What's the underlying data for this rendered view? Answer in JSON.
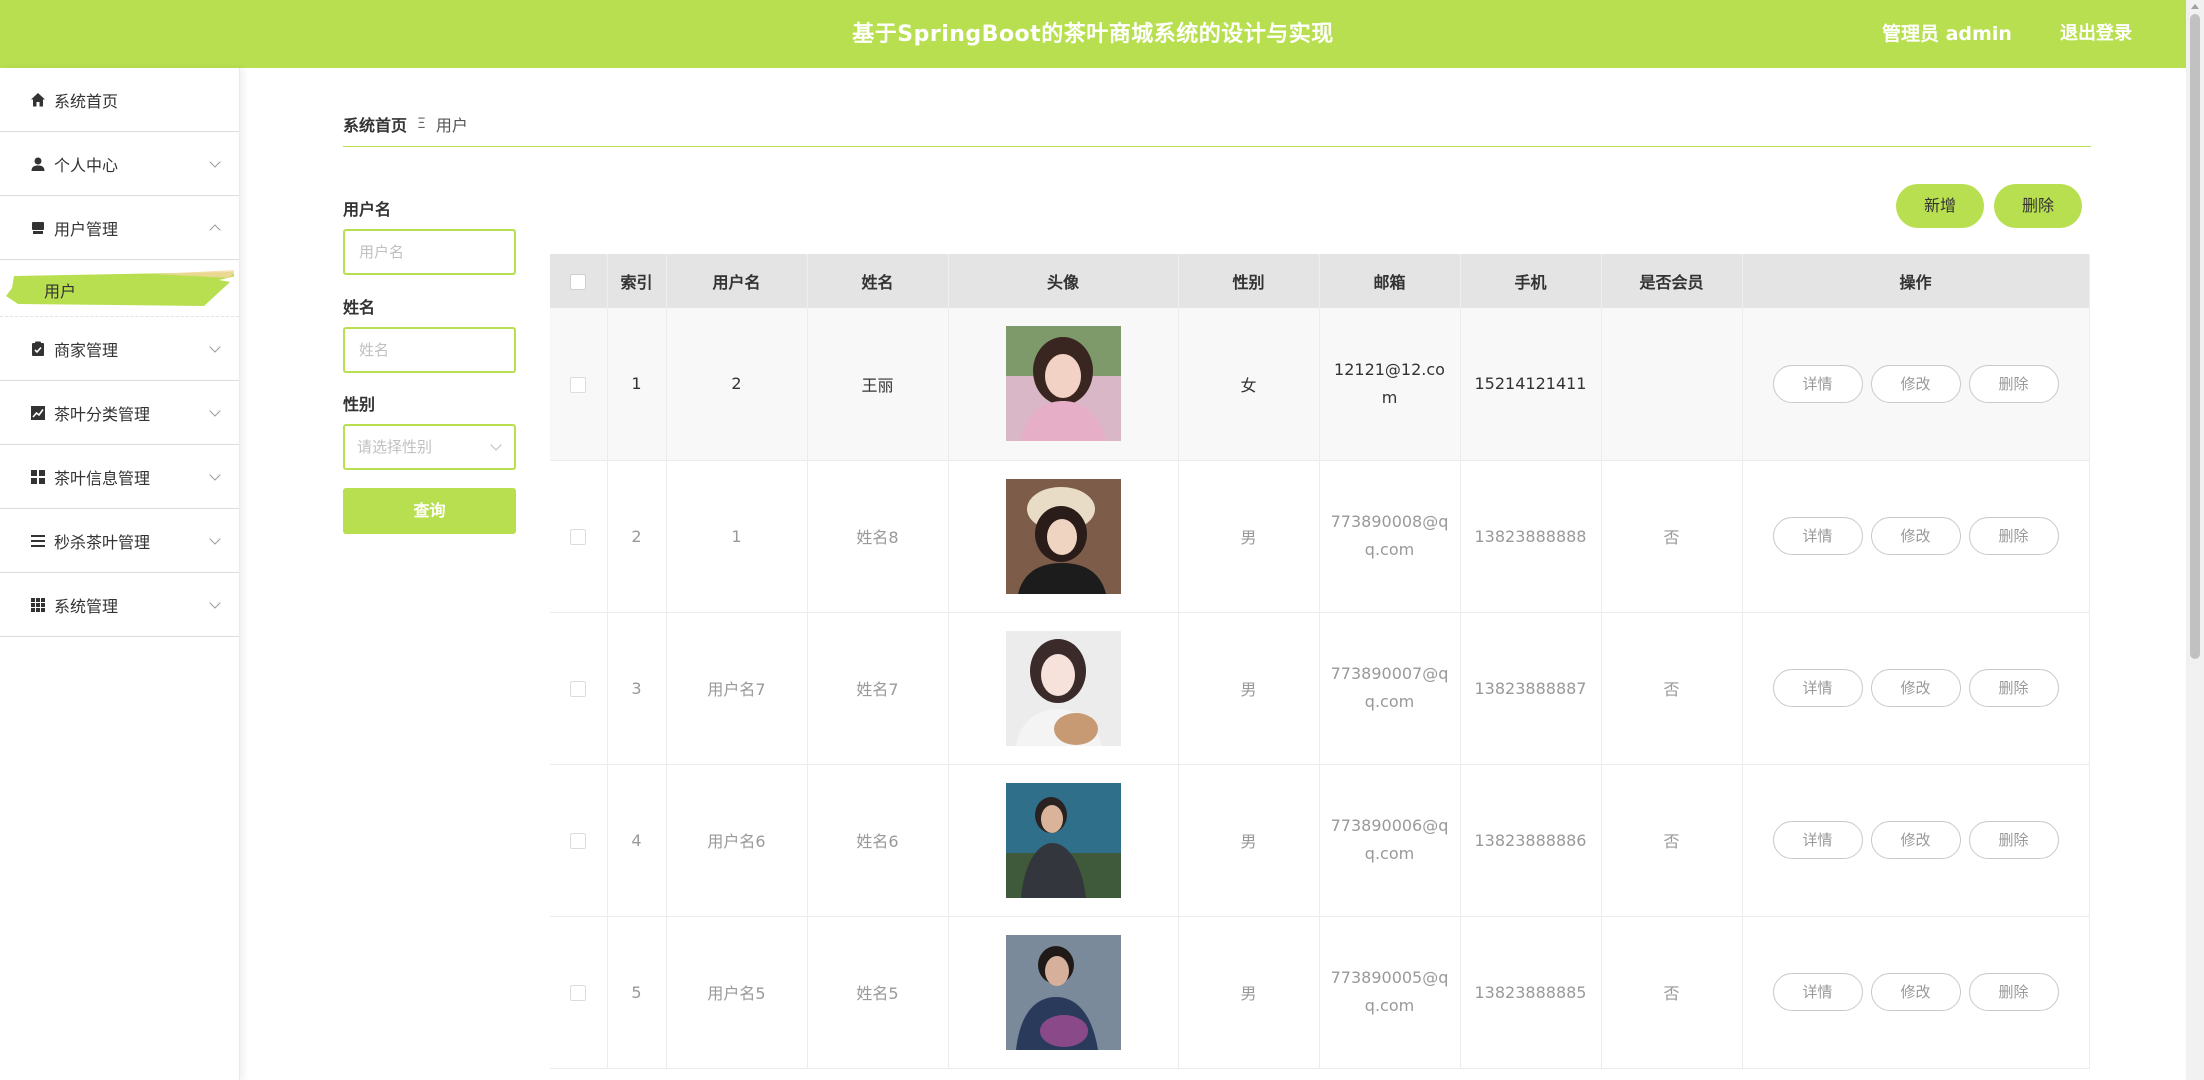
{
  "header": {
    "title": "基于SpringBoot的茶叶商城系统的设计与实现",
    "admin": "管理员 admin",
    "logout": "退出登录"
  },
  "sidebar": {
    "items": [
      {
        "label": "系统首页",
        "icon": "home-icon"
      },
      {
        "label": "个人中心",
        "icon": "user-icon"
      },
      {
        "label": "用户管理",
        "icon": "store-icon"
      },
      {
        "label": "商家管理",
        "icon": "clipboard-check-icon"
      },
      {
        "label": "茶叶分类管理",
        "icon": "chart-icon"
      },
      {
        "label": "茶叶信息管理",
        "icon": "grid-icon"
      },
      {
        "label": "秒杀茶叶管理",
        "icon": "list-icon"
      },
      {
        "label": "系统管理",
        "icon": "apps-icon"
      }
    ],
    "sub_active": "用户"
  },
  "breadcrumb": {
    "home": "系统首页",
    "separator": "Ξ",
    "current": "用户"
  },
  "search": {
    "username_label": "用户名",
    "username_placeholder": "用户名",
    "name_label": "姓名",
    "name_placeholder": "姓名",
    "gender_label": "性别",
    "gender_placeholder": "请选择性别",
    "query_button": "查询"
  },
  "actions": {
    "add": "新增",
    "delete": "删除"
  },
  "table": {
    "headers": [
      "索引",
      "用户名",
      "姓名",
      "头像",
      "性别",
      "邮箱",
      "手机",
      "是否会员",
      "操作"
    ],
    "op_labels": {
      "detail": "详情",
      "edit": "修改",
      "delete": "删除"
    },
    "rows": [
      {
        "index": "1",
        "username": "2",
        "name": "王丽",
        "gender": "女",
        "email": "12121@12.com",
        "phone": "15214121411",
        "member": ""
      },
      {
        "index": "2",
        "username": "1",
        "name": "姓名8",
        "gender": "男",
        "email": "773890008@qq.com",
        "phone": "13823888888",
        "member": "否"
      },
      {
        "index": "3",
        "username": "用户名7",
        "name": "姓名7",
        "gender": "男",
        "email": "773890007@qq.com",
        "phone": "13823888887",
        "member": "否"
      },
      {
        "index": "4",
        "username": "用户名6",
        "name": "姓名6",
        "gender": "男",
        "email": "773890006@qq.com",
        "phone": "13823888886",
        "member": "否"
      },
      {
        "index": "5",
        "username": "用户名5",
        "name": "姓名5",
        "gender": "男",
        "email": "773890005@qq.com",
        "phone": "13823888885",
        "member": "否"
      }
    ]
  },
  "colors": {
    "accent": "#b8df4f",
    "header_text": "#ffffff",
    "table_header_bg": "#e4e4e4"
  }
}
